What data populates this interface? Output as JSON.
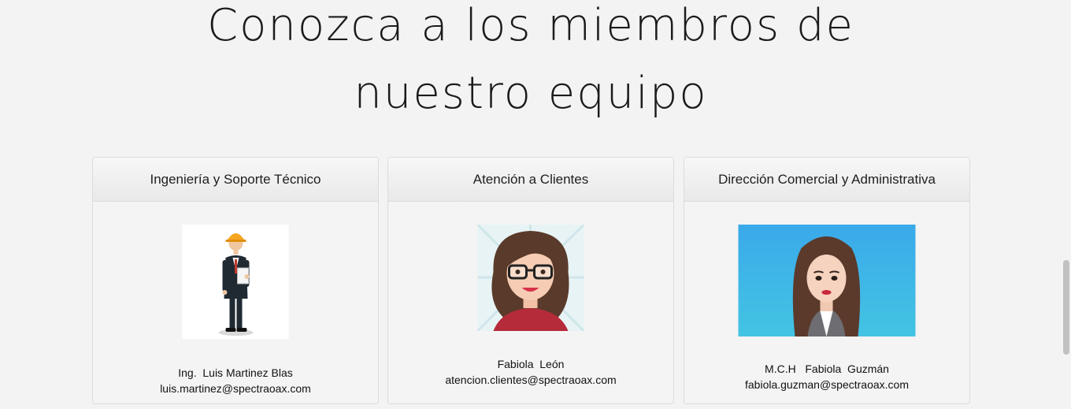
{
  "heading": {
    "line1": "Conozca a los miembros de",
    "line2": "nuestro equipo"
  },
  "team": [
    {
      "department": "Ingeniería y Soporte Técnico",
      "name": "Ing.  Luis Martinez Blas",
      "email": "luis.martinez@spectraoax.com",
      "photo_icon": "engineer-avatar-icon"
    },
    {
      "department": "Atención a Clientes",
      "name": "Fabiola  León",
      "email": "atencion.clientes@spectraoax.com",
      "photo_icon": "woman-glasses-avatar-icon"
    },
    {
      "department": "Dirección Comercial y Administrativa",
      "name": "M.C.H   Fabiola  Guzmán",
      "email": "fabiola.guzman@spectraoax.com",
      "photo_icon": "woman-avatar-icon"
    }
  ],
  "colors": {
    "background": "#f3f3f3",
    "card_background": "#f4f4f4",
    "card_border": "#dcdcdc",
    "avatar3_bg": "#3fb7e6"
  }
}
